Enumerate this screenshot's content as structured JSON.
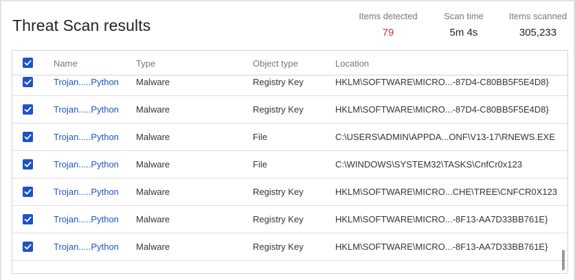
{
  "header": {
    "title": "Threat Scan results",
    "stats": {
      "detected_label": "Items detected",
      "detected_value": "79",
      "time_label": "Scan time",
      "time_value": "5m 4s",
      "scanned_label": "Items scanned",
      "scanned_value": "305,233"
    }
  },
  "table": {
    "columns": [
      "Name",
      "Type",
      "Object type",
      "Location"
    ],
    "rows": [
      {
        "name": "Trojan.....Python",
        "type": "Malware",
        "object_type": "Registry Key",
        "location": "HKLM\\SOFTWARE\\MICRO...-87D4-C80BB5F5E4D8}"
      },
      {
        "name": "Trojan.....Python",
        "type": "Malware",
        "object_type": "Registry Key",
        "location": "HKLM\\SOFTWARE\\MICRO...-87D4-C80BB5F5E4D8}"
      },
      {
        "name": "Trojan.....Python",
        "type": "Malware",
        "object_type": "File",
        "location": "C:\\USERS\\ADMIN\\APPDA...ONF\\V13-17\\RNEWS.EXE"
      },
      {
        "name": "Trojan.....Python",
        "type": "Malware",
        "object_type": "File",
        "location": "C:\\WINDOWS\\SYSTEM32\\TASKS\\CnfCr0x123"
      },
      {
        "name": "Trojan.....Python",
        "type": "Malware",
        "object_type": "Registry Key",
        "location": "HKLM\\SOFTWARE\\MICRO...CHE\\TREE\\CNFCR0X123"
      },
      {
        "name": "Trojan.....Python",
        "type": "Malware",
        "object_type": "Registry Key",
        "location": "HKLM\\SOFTWARE\\MICRO...-8F13-AA7D33BB761E}"
      },
      {
        "name": "Trojan.....Python",
        "type": "Malware",
        "object_type": "Registry Key",
        "location": "HKLM\\SOFTWARE\\MICRO...-8F13-AA7D33BB761E}"
      }
    ]
  },
  "colors": {
    "accent": "#1e52c7",
    "alert": "#c0392b"
  }
}
